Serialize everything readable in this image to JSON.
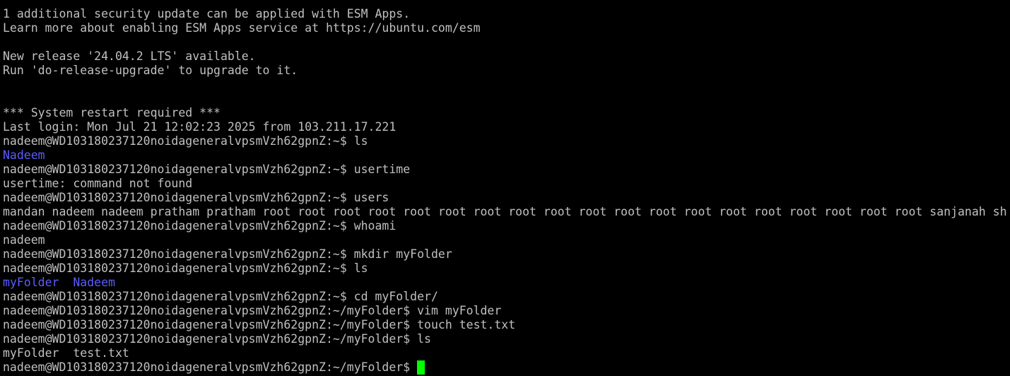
{
  "colors": {
    "background": "#000000",
    "foreground": "#c0c0c0",
    "directory": "#5c5cff",
    "cursor": "#00ff00"
  },
  "lines": [
    [
      {
        "text": "1 additional security update can be applied with ESM Apps."
      }
    ],
    [
      {
        "text": "Learn more about enabling ESM Apps service at https://ubuntu.com/esm"
      }
    ],
    [],
    [
      {
        "text": "New release '24.04.2 LTS' available."
      }
    ],
    [
      {
        "text": "Run 'do-release-upgrade' to upgrade to it."
      }
    ],
    [],
    [],
    [
      {
        "text": "*** System restart required ***"
      }
    ],
    [
      {
        "text": "Last login: Mon Jul 21 12:02:23 2025 from 103.211.17.221"
      }
    ],
    [
      {
        "text": "nadeem@WD103180237120noidageneralvpsmVzh62gpnZ:~$ ls"
      }
    ],
    [
      {
        "text": "Nadeem",
        "kind": "dir"
      }
    ],
    [
      {
        "text": "nadeem@WD103180237120noidageneralvpsmVzh62gpnZ:~$ usertime"
      }
    ],
    [
      {
        "text": "usertime: command not found"
      }
    ],
    [
      {
        "text": "nadeem@WD103180237120noidageneralvpsmVzh62gpnZ:~$ users"
      }
    ],
    [
      {
        "text": "mandan nadeem nadeem pratham pratham root root root root root root root root root root root root root root root root root root root sanjanah sh"
      }
    ],
    [
      {
        "text": "nadeem@WD103180237120noidageneralvpsmVzh62gpnZ:~$ whoami"
      }
    ],
    [
      {
        "text": "nadeem"
      }
    ],
    [
      {
        "text": "nadeem@WD103180237120noidageneralvpsmVzh62gpnZ:~$ mkdir myFolder"
      }
    ],
    [
      {
        "text": "nadeem@WD103180237120noidageneralvpsmVzh62gpnZ:~$ ls"
      }
    ],
    [
      {
        "text": "myFolder",
        "kind": "dir"
      },
      {
        "text": "  "
      },
      {
        "text": "Nadeem",
        "kind": "dir"
      }
    ],
    [
      {
        "text": "nadeem@WD103180237120noidageneralvpsmVzh62gpnZ:~$ cd myFolder/"
      }
    ],
    [
      {
        "text": "nadeem@WD103180237120noidageneralvpsmVzh62gpnZ:~/myFolder$ vim myFolder"
      }
    ],
    [
      {
        "text": "nadeem@WD103180237120noidageneralvpsmVzh62gpnZ:~/myFolder$ touch test.txt"
      }
    ],
    [
      {
        "text": "nadeem@WD103180237120noidageneralvpsmVzh62gpnZ:~/myFolder$ ls"
      }
    ],
    [
      {
        "text": "myFolder  test.txt"
      }
    ]
  ],
  "prompt": {
    "text": "nadeem@WD103180237120noidageneralvpsmVzh62gpnZ:~/myFolder$ "
  }
}
